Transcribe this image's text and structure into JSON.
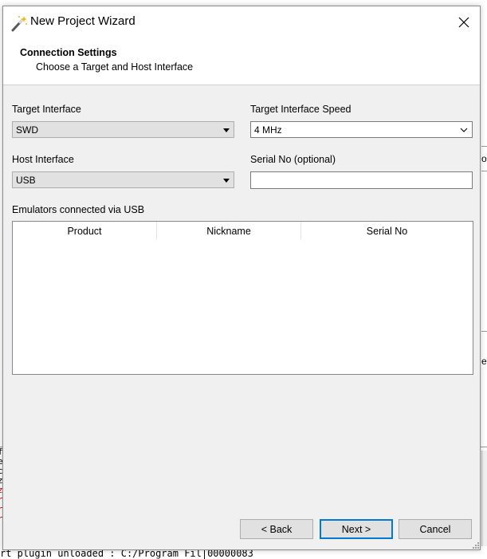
{
  "window": {
    "title": "New Project Wizard",
    "icon": "wand-icon",
    "close_icon": "close-icon"
  },
  "header": {
    "title": "Connection Settings",
    "subtitle": "Choose a Target and Host Interface"
  },
  "form": {
    "target_interface": {
      "label": "Target Interface",
      "value": "SWD"
    },
    "target_speed": {
      "label": "Target Interface Speed",
      "value": "4 MHz"
    },
    "host_interface": {
      "label": "Host Interface",
      "value": "USB"
    },
    "serial_no": {
      "label": "Serial No (optional)",
      "value": ""
    }
  },
  "emulators": {
    "label": "Emulators connected via USB",
    "columns": [
      "Product",
      "Nickname",
      "Serial No"
    ]
  },
  "buttons": {
    "back": "< Back",
    "next": "Next >",
    "cancel": "Cancel"
  },
  "background": {
    "right_glyph": "o",
    "right_glyph2": "e",
    "console_left_glyphs": [
      "f",
      "e",
      "c",
      "z",
      "z",
      "r",
      "r",
      "r"
    ],
    "console_bottom_line": "rt plugin unloaded : C:/Program Fil|00000083"
  },
  "colors": {
    "dialog_bg": "#f0f0f0",
    "default_button_border": "#0078d7",
    "console_error": "#c00000"
  }
}
